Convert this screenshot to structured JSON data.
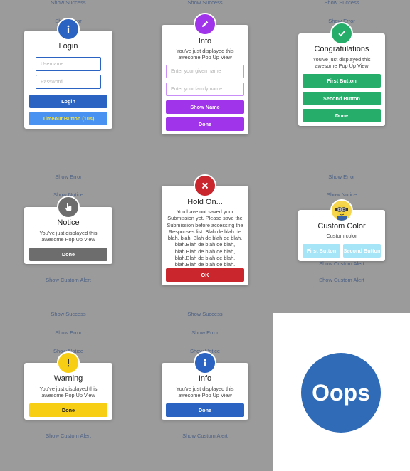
{
  "background_links": {
    "c1": [
      "Show Success",
      "Show Error",
      "Show Error",
      "Show Notice",
      "Show Custom Alert",
      "Show Success",
      "Show Error",
      "Show Notice",
      "Show Custom Alert"
    ],
    "c2": [
      "Show Success",
      "Show Success",
      "Show Error",
      "Show Notice",
      "Show Custom Alert"
    ],
    "c3": [
      "Show Success",
      "Show Error",
      "Show Error",
      "Show Notice",
      "Show Custom Alert",
      "Show Custom Alert"
    ]
  },
  "login": {
    "title": "Login",
    "username_placeholder": "Username",
    "password_placeholder": "Password",
    "login_button": "Login",
    "timeout_button": "Timeout Button (10s)",
    "icon": "info-icon",
    "color": "#2a63c2"
  },
  "info_form": {
    "title": "Info",
    "message": "You've just displayed this awesome Pop Up View",
    "given_placeholder": "Enter your given name",
    "family_placeholder": "Enter your family name",
    "show_name_button": "Show Name",
    "done_button": "Done",
    "icon": "pencil-icon",
    "color": "#a034ea"
  },
  "congrats": {
    "title": "Congratulations",
    "message": "You've just displayed this awesome Pop Up View",
    "first_button": "First Button",
    "second_button": "Second Button",
    "done_button": "Done",
    "icon": "checkmark-icon",
    "color": "#26ad6a"
  },
  "notice": {
    "title": "Notice",
    "message": "You've just displayed this awesome Pop Up View",
    "done_button": "Done",
    "icon": "pointer-hand-icon",
    "color": "#6d6d6d"
  },
  "hold_on": {
    "title": "Hold On...",
    "message": "You have not saved your Submission yet. Please save the Submission before accessing the Responses list. Blah de blah de blah, blah. Blah de blah de blah, blah.Blah de blah de blah, blah.Blah de blah de blah, blah.Blah de blah de blah, blah.Blah de blah de blah.",
    "ok_button": "OK",
    "icon": "close-x-icon",
    "color": "#c9262e"
  },
  "custom_color": {
    "title": "Custom Color",
    "message": "Custom color",
    "first_button": "First Button",
    "second_button": "Second Button",
    "icon": "minion-avatar-icon",
    "color": "#a6e4f7"
  },
  "warning": {
    "title": "Warning",
    "message": "You've just displayed this awesome Pop Up View",
    "done_button": "Done",
    "icon": "exclamation-icon",
    "color": "#f7ce14"
  },
  "info_small": {
    "title": "Info",
    "message": "You've just displayed this awesome Pop Up View",
    "done_button": "Done",
    "icon": "info-icon",
    "color": "#2a63c2"
  },
  "oops": {
    "label": "Oops"
  }
}
